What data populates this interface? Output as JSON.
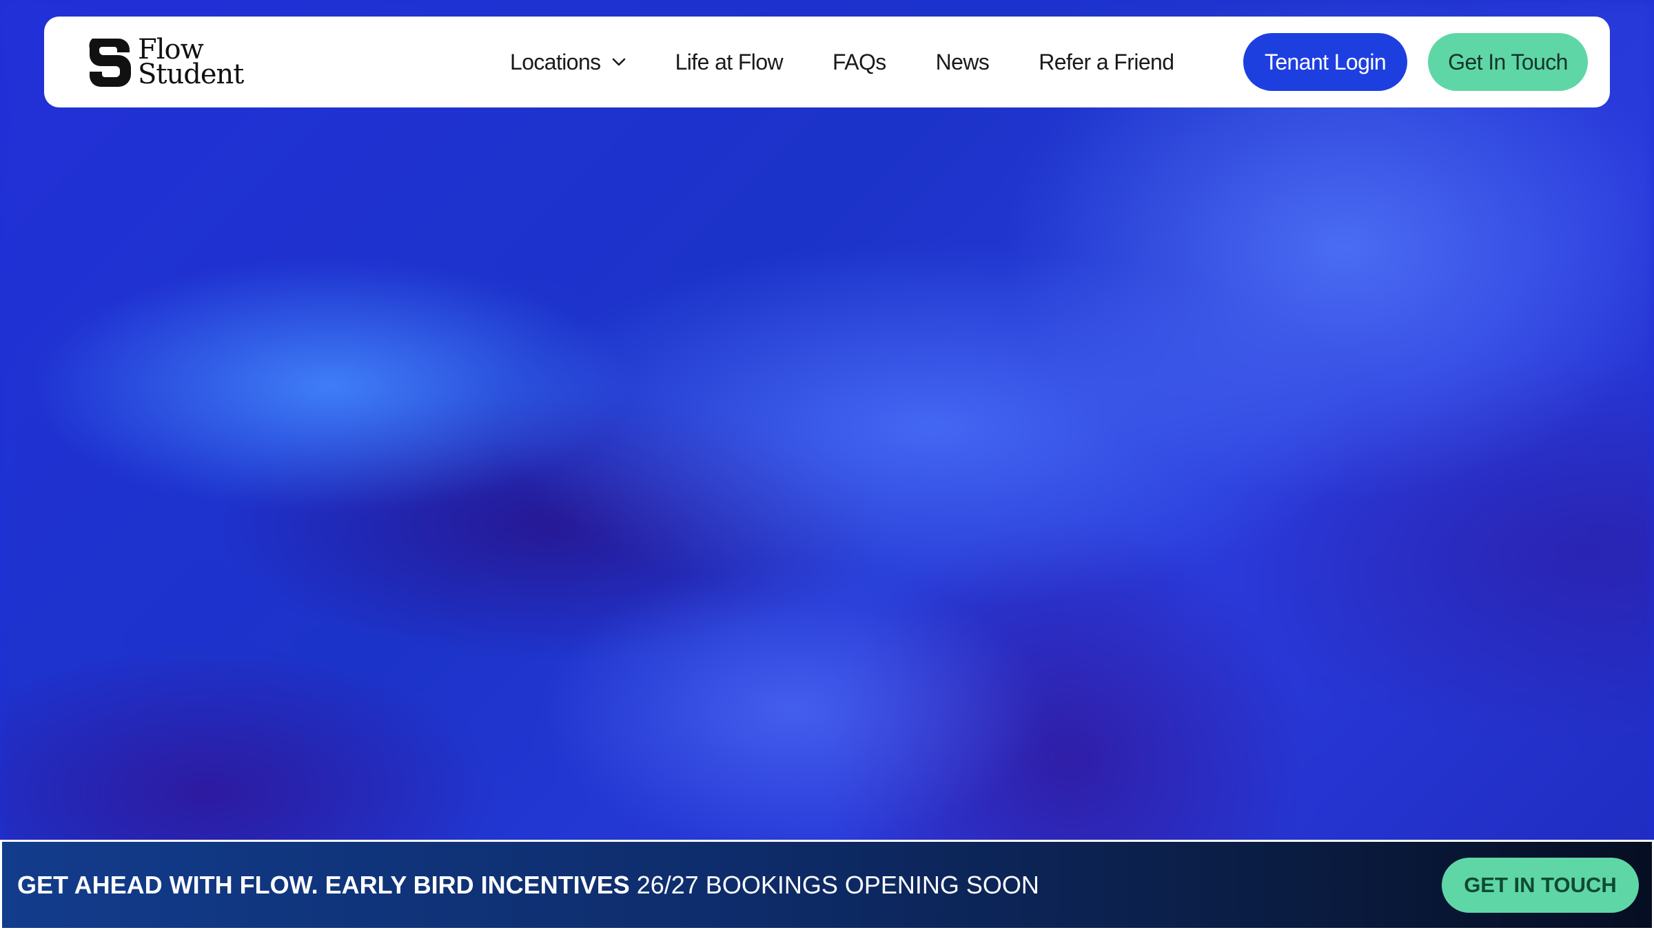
{
  "brand": {
    "name_line1": "Flow",
    "name_line2": "Student",
    "logo_icon": "flow-s-logo-icon"
  },
  "nav": {
    "items": [
      {
        "label": "Locations",
        "has_dropdown": true
      },
      {
        "label": "Life at Flow"
      },
      {
        "label": "FAQs"
      },
      {
        "label": "News"
      },
      {
        "label": "Refer a Friend"
      }
    ],
    "tenant_login_label": "Tenant Login",
    "get_in_touch_label": "Get In Touch"
  },
  "banner": {
    "headline_bold": "GET AHEAD WITH FLOW. EARLY BIRD INCENTIVES",
    "headline_regular": "26/27 BOOKINGS OPENING SOON",
    "cta_label": "GET IN TOUCH"
  },
  "colors": {
    "primary_blue": "#1e3fe0",
    "accent_green": "#5fd6a6",
    "banner_dark": "#0a1b3f"
  }
}
